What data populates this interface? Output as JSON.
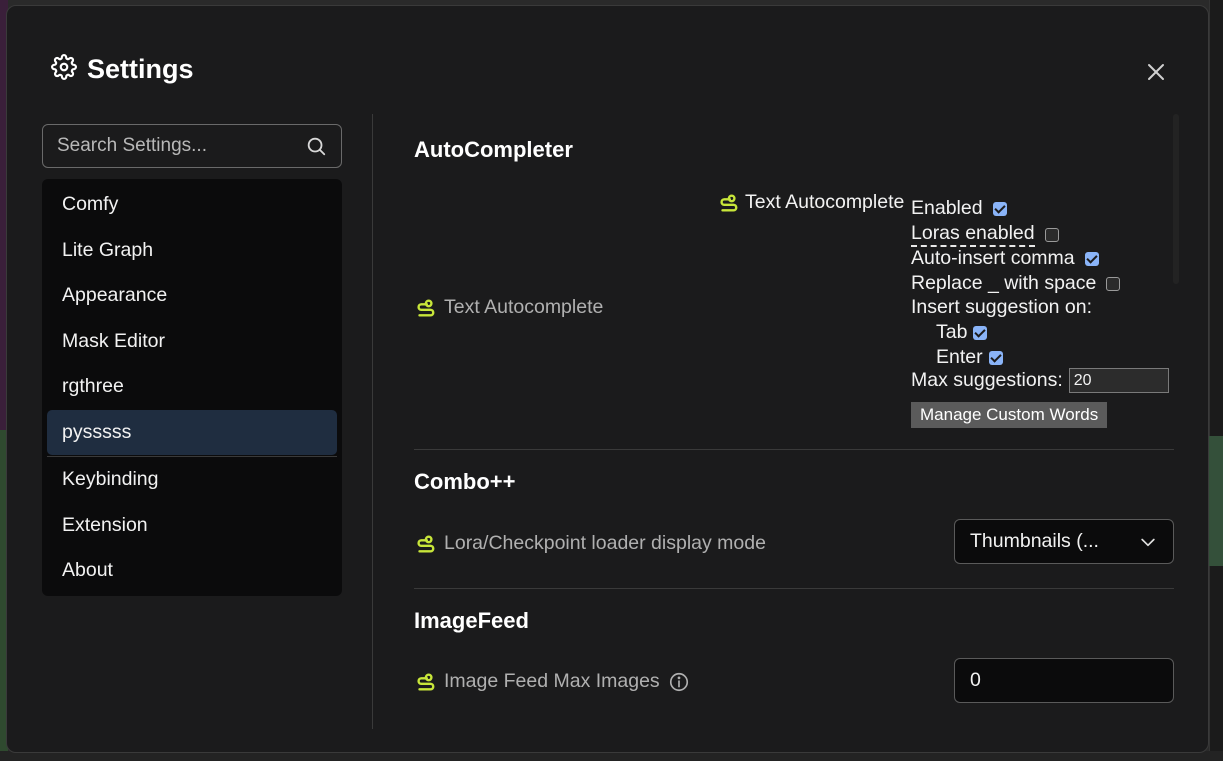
{
  "dialog": {
    "title": "Settings",
    "icon": "gear-icon"
  },
  "search": {
    "placeholder": "Search Settings..."
  },
  "nav": {
    "items": [
      {
        "label": "Comfy"
      },
      {
        "label": "Lite Graph"
      },
      {
        "label": "Appearance"
      },
      {
        "label": "Mask Editor"
      },
      {
        "label": "rgthree"
      },
      {
        "label": "pysssss",
        "active": true
      },
      {
        "label": "Keybinding"
      },
      {
        "label": "Extension"
      },
      {
        "label": "About"
      }
    ]
  },
  "sections": {
    "autocompleter": {
      "title": "AutoCompleter",
      "setting_label": "Text Autocomplete",
      "panel": {
        "header": "Text Autocomplete",
        "enabled_label": "Enabled",
        "enabled": true,
        "loras_label": "Loras enabled",
        "loras": false,
        "comma_label": "Auto-insert comma",
        "comma": true,
        "replace_label": "Replace _ with space",
        "replace": false,
        "insert_label": "Insert suggestion on:",
        "tab_label": "Tab",
        "tab": true,
        "enter_label": "Enter",
        "enter": true,
        "max_label": "Max suggestions:",
        "max_value": "20",
        "manage_button": "Manage Custom Words"
      }
    },
    "combo": {
      "title": "Combo++",
      "setting_label": "Lora/Checkpoint loader display mode",
      "select_value": "Thumbnails (..."
    },
    "imagefeed": {
      "title": "ImageFeed",
      "setting_label": "Image Feed Max Images",
      "input_value": "0"
    }
  },
  "colors": {
    "accent": "#8ab4f8",
    "active_nav": "#1f2d40",
    "snake": "#c8e63a"
  }
}
